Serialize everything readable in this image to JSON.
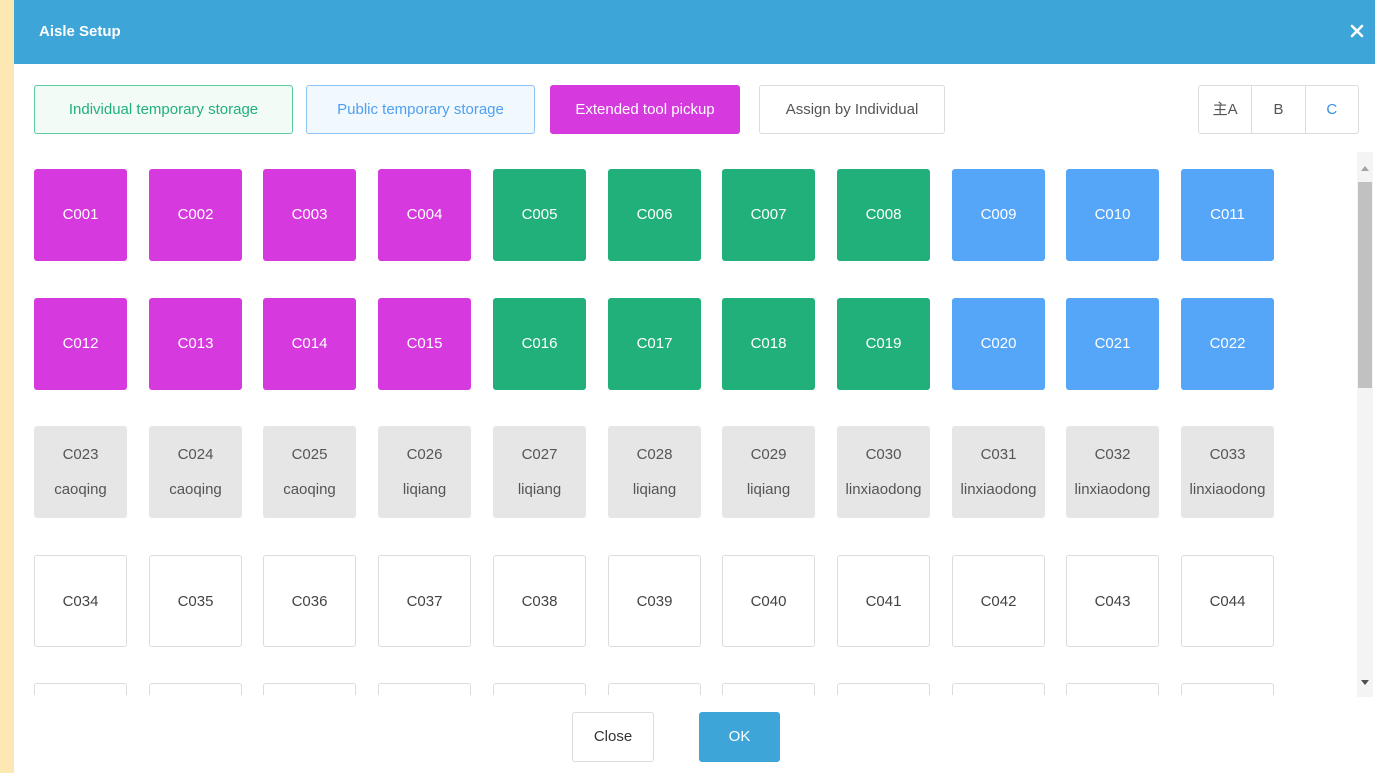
{
  "dialog": {
    "title": "Aisle Setup",
    "close_icon": "close-icon"
  },
  "legend": {
    "individual_label": "Individual temporary storage",
    "public_label": "Public temporary storage",
    "extended_label": "Extended tool pickup",
    "assign_label": "Assign by Individual"
  },
  "groups": {
    "items": [
      "主A",
      "B",
      "C"
    ],
    "active": "C"
  },
  "colors": {
    "header": "#3ea5d9",
    "individual": "#22b07a",
    "public": "#55a5f8",
    "extended": "#d63ade",
    "occupied": "#e6e6e6"
  },
  "aisles": [
    {
      "code": "C001",
      "type": "extended"
    },
    {
      "code": "C002",
      "type": "extended"
    },
    {
      "code": "C003",
      "type": "extended"
    },
    {
      "code": "C004",
      "type": "extended"
    },
    {
      "code": "C005",
      "type": "individual"
    },
    {
      "code": "C006",
      "type": "individual"
    },
    {
      "code": "C007",
      "type": "individual"
    },
    {
      "code": "C008",
      "type": "individual"
    },
    {
      "code": "C009",
      "type": "public"
    },
    {
      "code": "C010",
      "type": "public"
    },
    {
      "code": "C011",
      "type": "public"
    },
    {
      "code": "C012",
      "type": "extended"
    },
    {
      "code": "C013",
      "type": "extended"
    },
    {
      "code": "C014",
      "type": "extended"
    },
    {
      "code": "C015",
      "type": "extended"
    },
    {
      "code": "C016",
      "type": "individual"
    },
    {
      "code": "C017",
      "type": "individual"
    },
    {
      "code": "C018",
      "type": "individual"
    },
    {
      "code": "C019",
      "type": "individual"
    },
    {
      "code": "C020",
      "type": "public"
    },
    {
      "code": "C021",
      "type": "public"
    },
    {
      "code": "C022",
      "type": "public"
    },
    {
      "code": "C023",
      "type": "assigned",
      "owner": "caoqing"
    },
    {
      "code": "C024",
      "type": "assigned",
      "owner": "caoqing"
    },
    {
      "code": "C025",
      "type": "assigned",
      "owner": "caoqing"
    },
    {
      "code": "C026",
      "type": "assigned",
      "owner": "liqiang"
    },
    {
      "code": "C027",
      "type": "assigned",
      "owner": "liqiang"
    },
    {
      "code": "C028",
      "type": "assigned",
      "owner": "liqiang"
    },
    {
      "code": "C029",
      "type": "assigned",
      "owner": "liqiang"
    },
    {
      "code": "C030",
      "type": "assigned",
      "owner": "linxiaodong"
    },
    {
      "code": "C031",
      "type": "assigned",
      "owner": "linxiaodong"
    },
    {
      "code": "C032",
      "type": "assigned",
      "owner": "linxiaodong"
    },
    {
      "code": "C033",
      "type": "assigned",
      "owner": "linxiaodong"
    },
    {
      "code": "C034",
      "type": "free"
    },
    {
      "code": "C035",
      "type": "free"
    },
    {
      "code": "C036",
      "type": "free"
    },
    {
      "code": "C037",
      "type": "free"
    },
    {
      "code": "C038",
      "type": "free"
    },
    {
      "code": "C039",
      "type": "free"
    },
    {
      "code": "C040",
      "type": "free"
    },
    {
      "code": "C041",
      "type": "free"
    },
    {
      "code": "C042",
      "type": "free"
    },
    {
      "code": "C043",
      "type": "free"
    },
    {
      "code": "C044",
      "type": "free"
    },
    {
      "code": "",
      "type": "free"
    },
    {
      "code": "",
      "type": "free"
    },
    {
      "code": "",
      "type": "free"
    },
    {
      "code": "",
      "type": "free"
    },
    {
      "code": "",
      "type": "free"
    },
    {
      "code": "",
      "type": "free"
    },
    {
      "code": "",
      "type": "free"
    },
    {
      "code": "",
      "type": "free"
    },
    {
      "code": "",
      "type": "free"
    },
    {
      "code": "",
      "type": "free"
    },
    {
      "code": "",
      "type": "free"
    }
  ],
  "footer": {
    "close_label": "Close",
    "ok_label": "OK"
  }
}
